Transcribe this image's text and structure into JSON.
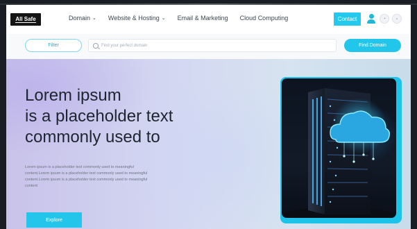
{
  "nav": {
    "logo_text": "All Safe",
    "menu": [
      {
        "label": "Domain",
        "has_dropdown": true
      },
      {
        "label": "Website & Hosting",
        "has_dropdown": true
      },
      {
        "label": "Email & Marketing",
        "has_dropdown": false
      },
      {
        "label": "Cloud Computing",
        "has_dropdown": false
      }
    ],
    "contact_label": "Contact",
    "icons": [
      "user-icon",
      "bell-icon",
      "cart-icon"
    ]
  },
  "search": {
    "filter_label": "Filter",
    "placeholder": "Find your perfect domain",
    "button_label": "Find Domain"
  },
  "hero": {
    "headline_lines": [
      "Lorem ipsum",
      "is a placeholder text",
      "commonly used to"
    ],
    "lead_lines": [
      "Lorem ipsum is a placeholder text commonly used to meaningful",
      "content.Lorem ipsum is a placeholder text commonly used to meaningful",
      "content.Lorem ipsum is a placeholder text commonly used to meaningful",
      "content"
    ],
    "explore_label": "Explore"
  },
  "colors": {
    "accent": "#23c6ea",
    "text_dark": "#1e2530",
    "text_muted": "#6d7480"
  }
}
